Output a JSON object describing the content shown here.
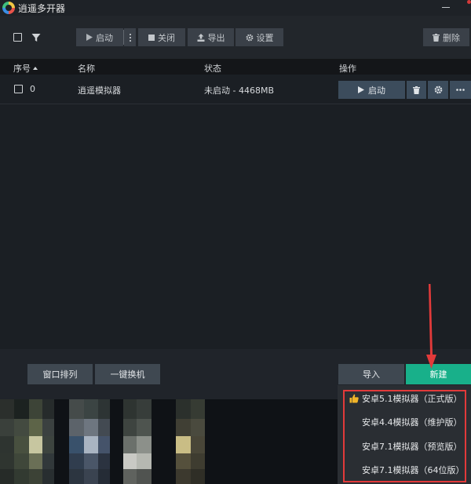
{
  "window": {
    "title": "逍遥多开器"
  },
  "toolbar": {
    "start_label": "启动",
    "close_label": "关闭",
    "export_label": "导出",
    "settings_label": "设置",
    "delete_label": "删除"
  },
  "table": {
    "columns": {
      "index": "序号",
      "name": "名称",
      "status": "状态",
      "actions": "操作"
    },
    "rows": [
      {
        "index": "0",
        "name": "逍遥模拟器",
        "status": "未启动 - 4468MB",
        "start_label": "启动"
      }
    ]
  },
  "bottom": {
    "arrange_label": "窗口排列",
    "switch_label": "一键换机",
    "import_label": "导入",
    "new_label": "新建"
  },
  "dropdown": {
    "items": [
      {
        "label": "安卓5.1模拟器（正式版）",
        "recommended": true
      },
      {
        "label": "安卓4.4模拟器（维护版）",
        "recommended": false
      },
      {
        "label": "安卓7.1模拟器（预览版）",
        "recommended": false
      },
      {
        "label": "安卓7.1模拟器（64位版）",
        "recommended": false
      }
    ]
  },
  "colors": {
    "accent_green": "#18b08a",
    "annotation_red": "#e23a3a",
    "recommend_icon": "#f0b429"
  }
}
